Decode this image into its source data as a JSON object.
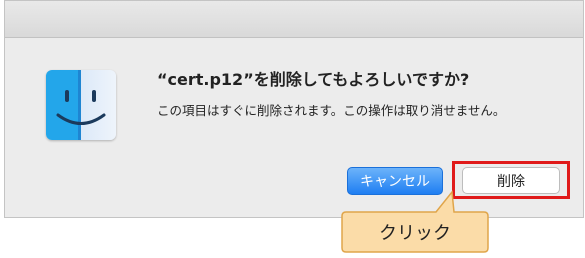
{
  "dialog": {
    "title": "“cert.p12”を削除してもよろしいですか?",
    "message": "この項目はすぐに削除されます。この操作は取り消せません。",
    "cancel_label": "キャンセル",
    "delete_label": "削除"
  },
  "annotation": {
    "callout_text": "クリック",
    "highlight_color": "#e01a1a",
    "callout_fill": "#fbdca8",
    "callout_border": "#e0a54a"
  },
  "colors": {
    "primary_button": "#1e7ef2",
    "dialog_background": "#ececec"
  },
  "icons": {
    "app_icon": "finder-icon"
  }
}
